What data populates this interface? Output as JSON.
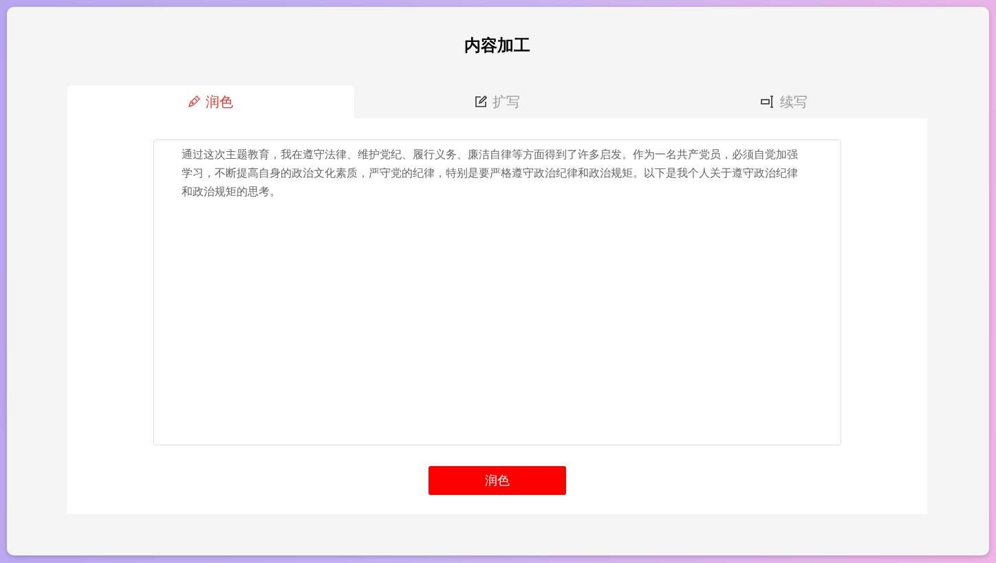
{
  "title": "内容加工",
  "tabs": [
    {
      "label": "润色",
      "kind": "polish",
      "selected": true
    },
    {
      "label": "扩写",
      "kind": "expand",
      "selected": false
    },
    {
      "label": "续写",
      "kind": "continue",
      "selected": false
    }
  ],
  "editor": {
    "value": "通过这次主题教育，我在遵守法律、维护党纪、履行义务、廉洁自律等方面得到了许多启发。作为一名共产党员，必须自觉加强学习，不断提高自身的政治文化素质，严守党的纪律，特别是要严格遵守政治纪律和政治规矩。以下是我个人关于遵守政治纪律和政治规矩的思考。"
  },
  "button": "润色"
}
